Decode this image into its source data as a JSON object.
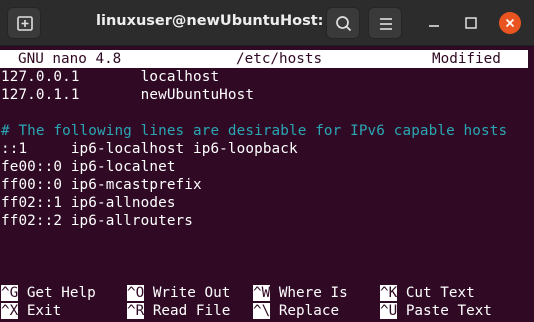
{
  "titlebar": {
    "title": "linuxuser@newUbuntuHost: ~",
    "new_tab_icon": "new-tab-icon",
    "search_icon": "search-icon",
    "menu_icon": "hamburger-menu-icon",
    "minimize_icon": "minimize-icon",
    "maximize_icon": "maximize-icon",
    "close_icon": "close-icon",
    "close_color": "#e95420"
  },
  "nano": {
    "version": "GNU nano 4.8",
    "filename": "/etc/hosts",
    "status": "Modified"
  },
  "file_lines": [
    "127.0.0.1       localhost",
    "127.0.1.1       newUbuntuHost",
    "",
    "# The following lines are desirable for IPv6 capable hosts",
    "::1     ip6-localhost ip6-loopback",
    "fe00::0 ip6-localnet",
    "ff00::0 ip6-mcastprefix",
    "ff02::1 ip6-allnodes",
    "ff02::2 ip6-allrouters"
  ],
  "shortcuts": [
    {
      "key": "^G",
      "label": "Get Help"
    },
    {
      "key": "^O",
      "label": "Write Out"
    },
    {
      "key": "^W",
      "label": "Where Is"
    },
    {
      "key": "^K",
      "label": "Cut Text"
    },
    {
      "key": "^X",
      "label": "Exit"
    },
    {
      "key": "^R",
      "label": "Read File"
    },
    {
      "key": "^\\",
      "label": "Replace"
    },
    {
      "key": "^U",
      "label": "Paste Text"
    }
  ],
  "colors": {
    "terminal_bg": "#300a24",
    "comment": "#2aa6b5",
    "text": "#ffffff"
  }
}
